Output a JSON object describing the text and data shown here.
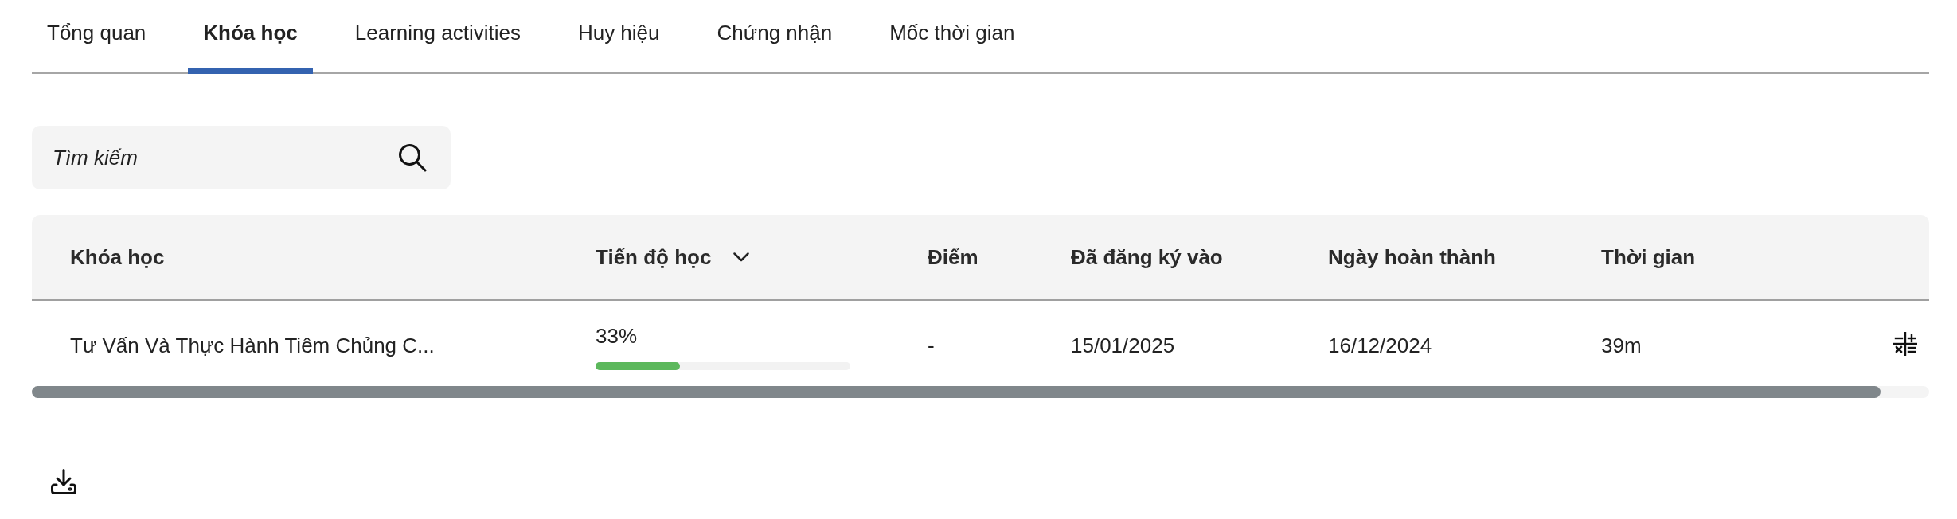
{
  "tabs": [
    {
      "label": "Tổng quan",
      "selected": false
    },
    {
      "label": "Khóa học",
      "selected": true
    },
    {
      "label": "Learning activities",
      "selected": false
    },
    {
      "label": "Huy hiệu",
      "selected": false
    },
    {
      "label": "Chứng nhận",
      "selected": false
    },
    {
      "label": "Mốc thời gian",
      "selected": false
    }
  ],
  "search": {
    "placeholder": "Tìm kiếm"
  },
  "table": {
    "columns": [
      {
        "label": "Khóa học",
        "sorted": false
      },
      {
        "label": "Tiến độ học",
        "sorted": true
      },
      {
        "label": "Điểm",
        "sorted": false
      },
      {
        "label": "Đã đăng ký vào",
        "sorted": false
      },
      {
        "label": "Ngày hoàn thành",
        "sorted": false
      },
      {
        "label": "Thời gian",
        "sorted": false
      }
    ],
    "rows": [
      {
        "course": "Tư Vấn Và Thực Hành Tiêm Chủng C...",
        "progress": {
          "reading": "33%",
          "level": 0.33
        },
        "score": "-",
        "enrolled": "15/01/2025",
        "completed": "16/12/2024",
        "duration": "39m"
      }
    ]
  }
}
